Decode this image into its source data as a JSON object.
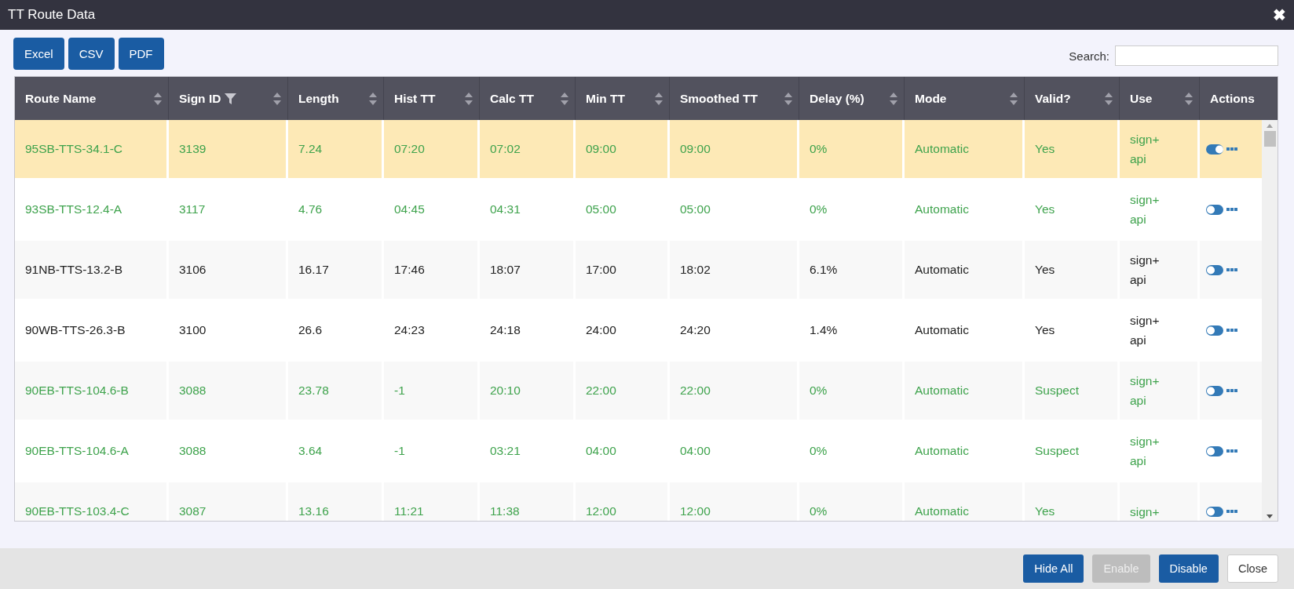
{
  "window": {
    "title": "TT Route Data",
    "close": "✖"
  },
  "export_buttons": [
    "Excel",
    "CSV",
    "PDF"
  ],
  "search": {
    "label": "Search:"
  },
  "table": {
    "columns": [
      {
        "label": "Route Name",
        "sortable": true,
        "filtered": false
      },
      {
        "label": "Sign ID",
        "sortable": true,
        "filtered": true
      },
      {
        "label": "Length",
        "sortable": true,
        "filtered": false
      },
      {
        "label": "Hist TT",
        "sortable": true,
        "filtered": false
      },
      {
        "label": "Calc TT",
        "sortable": true,
        "filtered": false
      },
      {
        "label": "Min TT",
        "sortable": true,
        "filtered": false
      },
      {
        "label": "Smoothed TT",
        "sortable": true,
        "filtered": false
      },
      {
        "label": "Delay (%)",
        "sortable": true,
        "filtered": false
      },
      {
        "label": "Mode",
        "sortable": true,
        "filtered": false
      },
      {
        "label": "Valid?",
        "sortable": true,
        "filtered": false
      },
      {
        "label": "Use",
        "sortable": true,
        "filtered": false
      },
      {
        "label": "Actions",
        "sortable": false,
        "filtered": false
      }
    ],
    "rows": [
      {
        "selected": true,
        "color": "#3fa34d",
        "cells": [
          "95SB-TTS-34.1-C",
          "3139",
          "7.24",
          "07:20",
          "07:02",
          "09:00",
          "09:00",
          "0%",
          "Automatic",
          "Yes"
        ],
        "use": [
          "sign+",
          "api"
        ],
        "enabled": true
      },
      {
        "selected": false,
        "color": "#3fa34d",
        "cells": [
          "93SB-TTS-12.4-A",
          "3117",
          "4.76",
          "04:45",
          "04:31",
          "05:00",
          "05:00",
          "0%",
          "Automatic",
          "Yes"
        ],
        "use": [
          "sign+",
          "api"
        ],
        "enabled": false
      },
      {
        "selected": false,
        "color": "#222222",
        "cells": [
          "91NB-TTS-13.2-B",
          "3106",
          "16.17",
          "17:46",
          "18:07",
          "17:00",
          "18:02",
          "6.1%",
          "Automatic",
          "Yes"
        ],
        "use": [
          "sign+",
          "api"
        ],
        "enabled": false
      },
      {
        "selected": false,
        "color": "#222222",
        "cells": [
          "90WB-TTS-26.3-B",
          "3100",
          "26.6",
          "24:23",
          "24:18",
          "24:00",
          "24:20",
          "1.4%",
          "Automatic",
          "Yes"
        ],
        "use": [
          "sign+",
          "api"
        ],
        "enabled": false
      },
      {
        "selected": false,
        "color": "#3fa34d",
        "cells": [
          "90EB-TTS-104.6-B",
          "3088",
          "23.78",
          "-1",
          "20:10",
          "22:00",
          "22:00",
          "0%",
          "Automatic",
          "Suspect"
        ],
        "use": [
          "sign+",
          "api"
        ],
        "enabled": false
      },
      {
        "selected": false,
        "color": "#3fa34d",
        "cells": [
          "90EB-TTS-104.6-A",
          "3088",
          "3.64",
          "-1",
          "03:21",
          "04:00",
          "04:00",
          "0%",
          "Automatic",
          "Suspect"
        ],
        "use": [
          "sign+",
          "api"
        ],
        "enabled": false
      },
      {
        "selected": false,
        "color": "#3fa34d",
        "cells": [
          "90EB-TTS-103.4-C",
          "3087",
          "13.16",
          "11:21",
          "11:38",
          "12:00",
          "12:00",
          "0%",
          "Automatic",
          "Yes"
        ],
        "use": [
          "sign+"
        ],
        "enabled": false
      }
    ]
  },
  "footer_buttons": [
    {
      "label": "Hide All",
      "kind": "primary",
      "disabled": false
    },
    {
      "label": "Enable",
      "kind": "primary",
      "disabled": true
    },
    {
      "label": "Disable",
      "kind": "primary",
      "disabled": false
    },
    {
      "label": "Close",
      "kind": "light",
      "disabled": false
    }
  ]
}
